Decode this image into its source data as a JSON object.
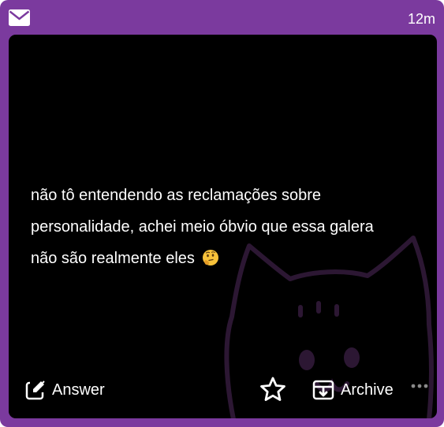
{
  "header": {
    "icon": "envelope-icon",
    "time": "12m"
  },
  "question": {
    "line1": "não tô entendendo as reclamações sobre",
    "line2": "personalidade, achei meio óbvio que essa galera",
    "line3": "não são realmente eles",
    "emoji": "thinking-face-emoji"
  },
  "actions": {
    "answer_label": "Answer",
    "archive_label": "Archive",
    "star_icon": "star-icon",
    "more_icon": "more-dots-icon"
  },
  "colors": {
    "frame": "#7b3a9e",
    "panel": "#000000",
    "text": "#ffffff"
  }
}
